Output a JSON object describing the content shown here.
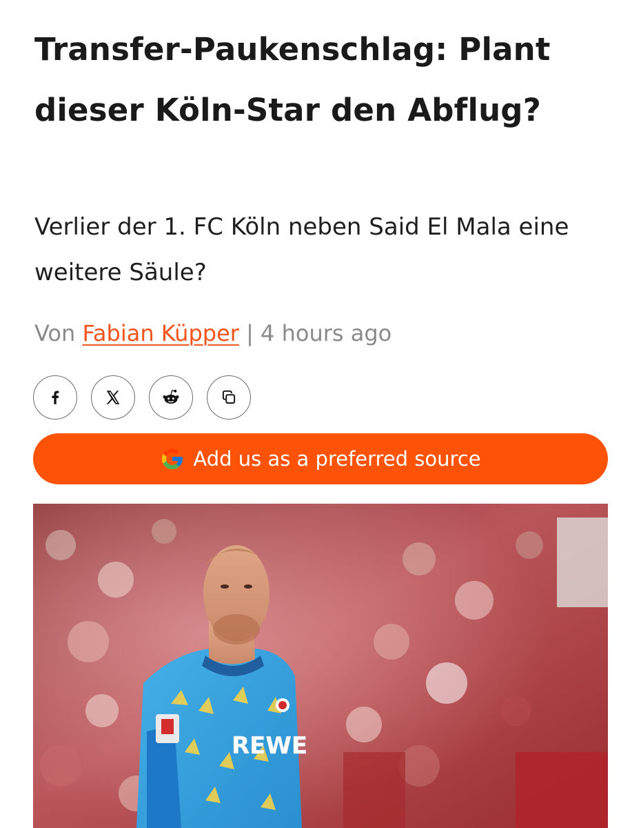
{
  "article": {
    "headline": "Transfer-Paukenschlag: Plant dieser Köln-Star den Abflug?",
    "subheadline": "Verlier der 1. FC Köln neben Said El Mala eine weitere Säule?",
    "byline": {
      "prefix": "Von",
      "author": "Fabian Küpper",
      "separator": "|",
      "time": "4 hours ago"
    }
  },
  "share": {
    "buttons": [
      {
        "icon": "facebook-icon"
      },
      {
        "icon": "x-icon"
      },
      {
        "icon": "reddit-icon"
      },
      {
        "icon": "copy-icon"
      }
    ]
  },
  "preferred_source": {
    "label": "Add us as a preferred source",
    "icon": "google-icon"
  },
  "hero_image": {
    "jersey_sponsor": "REWE",
    "description_colors": {
      "jersey": "#3aa6e0",
      "crowd": "#b63a3a"
    }
  },
  "colors": {
    "accent": "#fd5308",
    "author_link": "#f2541b",
    "meta_text": "#8a8a8a",
    "text": "#1a1a1a"
  }
}
